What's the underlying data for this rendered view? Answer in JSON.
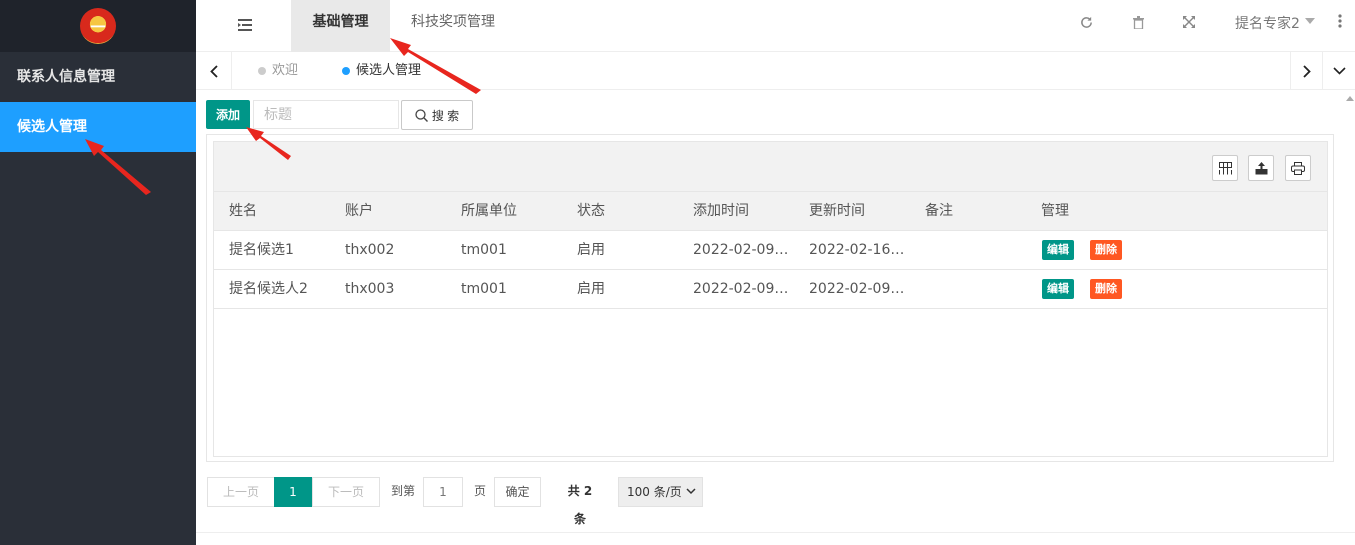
{
  "sidebar": {
    "logo_text": "一",
    "items": [
      {
        "label": "联系人信息管理"
      },
      {
        "label": "候选人管理"
      }
    ]
  },
  "header": {
    "tabs": [
      {
        "label": "基础管理"
      },
      {
        "label": "科技奖项管理"
      }
    ],
    "user": "提名专家2"
  },
  "tabbar": {
    "tabs": [
      {
        "label": "欢迎"
      },
      {
        "label": "候选人管理"
      }
    ]
  },
  "toolbar": {
    "add_label": "添加",
    "search_placeholder": "标题",
    "search_label": "搜 索"
  },
  "table": {
    "columns": [
      "姓名",
      "账户",
      "所属单位",
      "状态",
      "添加时间",
      "更新时间",
      "备注",
      "管理"
    ],
    "rows": [
      {
        "name": "提名候选1",
        "account": "thx002",
        "unit": "tm001",
        "status": "启用",
        "added": "2022-02-09…",
        "updated": "2022-02-16…",
        "note": ""
      },
      {
        "name": "提名候选人2",
        "account": "thx003",
        "unit": "tm001",
        "status": "启用",
        "added": "2022-02-09…",
        "updated": "2022-02-09…",
        "note": ""
      }
    ],
    "edit_label": "编辑",
    "delete_label": "删除"
  },
  "pagination": {
    "prev": "上一页",
    "current": "1",
    "next": "下一页",
    "goto": "到第",
    "input_value": "1",
    "unit": "页",
    "confirm": "确定",
    "total": "共 2 条",
    "page_size": "100 条/页"
  },
  "colors": {
    "sidebar_bg": "#2a2f38",
    "active_blue": "#1e9fff",
    "teal": "#009688",
    "orange": "#ff5722",
    "annotation_red": "#e8261e"
  }
}
